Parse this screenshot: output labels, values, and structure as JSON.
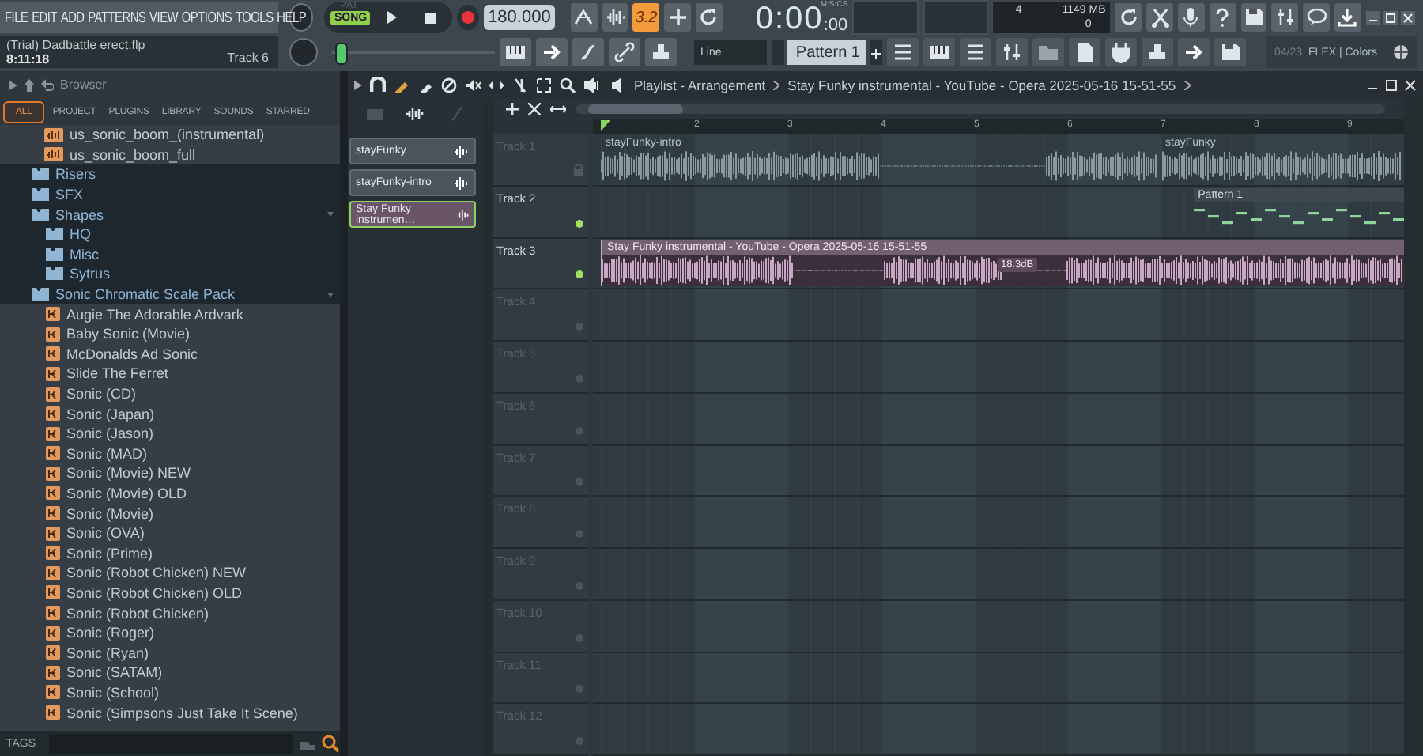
{
  "menu": [
    "FILE",
    "EDIT",
    "ADD",
    "PATTERNS",
    "VIEW",
    "OPTIONS",
    "TOOLS",
    "HELP"
  ],
  "project": {
    "title": "(Trial) Dadbattle erect.flp",
    "time": "8:11:18",
    "track": "Track 6"
  },
  "transport": {
    "modes": [
      {
        "label": "PAT",
        "selected": false
      },
      {
        "label": "SONG",
        "selected": true
      }
    ],
    "tempo": "180.000"
  },
  "toggle_button": {
    "label": "3.2",
    "on": true
  },
  "time_display": {
    "label": "M:S:CS",
    "time": "0:00",
    "sub": ":00"
  },
  "cpu": {
    "voices": "4",
    "memory": "1149 MB",
    "polyphony": "0"
  },
  "snap": "Line",
  "pattern_selector": "Pattern 1",
  "hint": {
    "counter": "04/23",
    "text": "FLEX | Colors"
  },
  "browser": {
    "title": "Browser",
    "tabs": [
      {
        "label": "ALL",
        "selected": true
      },
      {
        "label": "PROJECT",
        "selected": false
      },
      {
        "label": "PLUGINS",
        "selected": false
      },
      {
        "label": "LIBRARY",
        "selected": false
      },
      {
        "label": "SOUNDS",
        "selected": false
      },
      {
        "label": "STARRED",
        "selected": false
      }
    ],
    "scrolled_items": [
      {
        "label": "us_sonic_boom_(instrumental)",
        "kind": "audio"
      },
      {
        "label": "us_sonic_boom_full",
        "kind": "audio"
      }
    ],
    "tree": [
      {
        "label": "Risers",
        "kind": "folder",
        "expanded": false
      },
      {
        "label": "SFX",
        "kind": "folder",
        "expanded": false
      },
      {
        "label": "Shapes",
        "kind": "folder",
        "expanded": true,
        "children": [
          {
            "label": "HQ",
            "kind": "folder",
            "expanded": false
          },
          {
            "label": "Misc",
            "kind": "folder",
            "expanded": false
          },
          {
            "label": "Sytrus",
            "kind": "folder",
            "expanded": false
          }
        ]
      },
      {
        "label": "Sonic Chromatic Scale Pack",
        "kind": "folder",
        "expanded": true,
        "children": [
          {
            "label": "Augie The Adorable Ardvark",
            "kind": "preset"
          },
          {
            "label": "Baby Sonic (Movie)",
            "kind": "preset"
          },
          {
            "label": "McDonalds Ad Sonic",
            "kind": "preset"
          },
          {
            "label": "Slide The Ferret",
            "kind": "preset"
          },
          {
            "label": "Sonic (CD)",
            "kind": "preset"
          },
          {
            "label": "Sonic (Japan)",
            "kind": "preset"
          },
          {
            "label": "Sonic (Jason)",
            "kind": "preset"
          },
          {
            "label": "Sonic (MAD)",
            "kind": "preset"
          },
          {
            "label": "Sonic (Movie) NEW",
            "kind": "preset"
          },
          {
            "label": "Sonic (Movie) OLD",
            "kind": "preset"
          },
          {
            "label": "Sonic (Movie)",
            "kind": "preset"
          },
          {
            "label": "Sonic (OVA)",
            "kind": "preset"
          },
          {
            "label": "Sonic (Prime)",
            "kind": "preset"
          },
          {
            "label": "Sonic (Robot Chicken) NEW",
            "kind": "preset"
          },
          {
            "label": "Sonic (Robot Chicken) OLD",
            "kind": "preset"
          },
          {
            "label": "Sonic (Robot Chicken)",
            "kind": "preset"
          },
          {
            "label": "Sonic (Roger)",
            "kind": "preset"
          },
          {
            "label": "Sonic (Ryan)",
            "kind": "preset"
          },
          {
            "label": "Sonic (SATAM)",
            "kind": "preset"
          },
          {
            "label": "Sonic (School)",
            "kind": "preset"
          },
          {
            "label": "Sonic (Simpsons Just Take It Scene)",
            "kind": "preset"
          }
        ]
      }
    ],
    "tags_label": "TAGS"
  },
  "playlist": {
    "title": "Playlist - Arrangement",
    "subtitle": "Stay Funky instrumental - YouTube - Opera 2025-05-16 15-51-55",
    "clip_sources": [
      {
        "label": "stayFunky",
        "selected": false
      },
      {
        "label": "stayFunky-intro",
        "selected": false
      },
      {
        "label": "Stay Funky instrumen…",
        "selected": true
      }
    ],
    "bars": [
      "2",
      "3",
      "4",
      "5",
      "6",
      "7",
      "8",
      "9"
    ],
    "tracks": [
      {
        "name": "Track 1",
        "active": false,
        "locked": true,
        "clips": [
          {
            "kind": "audio",
            "label": "stayFunky-intro",
            "color": "#8a9aa0"
          },
          {
            "kind": "audio",
            "label": "stayFunky",
            "color": "#8a9aa0"
          }
        ]
      },
      {
        "name": "Track 2",
        "active": true,
        "locked": false,
        "clips": [
          {
            "kind": "pattern",
            "label": "Pattern 1",
            "color": "#8fd49a"
          }
        ]
      },
      {
        "name": "Track 3",
        "active": true,
        "locked": false,
        "clips": [
          {
            "kind": "audio",
            "label": "Stay Funky instrumental - YouTube - Opera 2025-05-16 15-51-55",
            "color": "#c9a8c6",
            "gain": "18.3dB"
          }
        ]
      },
      {
        "name": "Track 4",
        "active": false,
        "locked": false
      },
      {
        "name": "Track 5",
        "active": false,
        "locked": false
      },
      {
        "name": "Track 6",
        "active": false,
        "locked": false
      },
      {
        "name": "Track 7",
        "active": false,
        "locked": false
      },
      {
        "name": "Track 8",
        "active": false,
        "locked": false
      },
      {
        "name": "Track 9",
        "active": false,
        "locked": false
      },
      {
        "name": "Track 10",
        "active": false,
        "locked": false
      },
      {
        "name": "Track 11",
        "active": false,
        "locked": false
      },
      {
        "name": "Track 12",
        "active": false,
        "locked": false
      }
    ]
  }
}
